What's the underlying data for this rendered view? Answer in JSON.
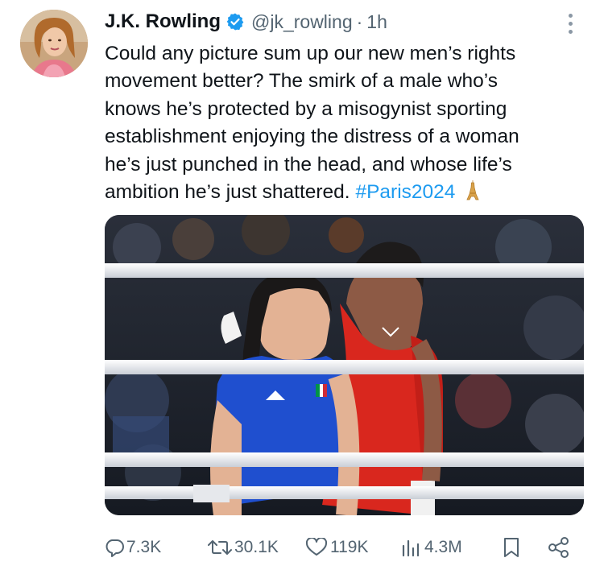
{
  "tweet": {
    "author": {
      "name": "J.K. Rowling",
      "handle": "@jk_rowling",
      "separator": "·",
      "time": "1h",
      "avatar_icon": "author-avatar",
      "verified_color": "#1d9bf0"
    },
    "text_lines": [
      "Could any picture sum up our new men’s rights",
      "movement better? The smirk of a male who’s",
      "knows he’s protected by a misogynist sporting",
      "establishment enjoying the distress of a woman",
      "he’s just punched in the head, and whose life’s",
      "ambition he’s just shattered."
    ],
    "hashtag": "#Paris2024",
    "emoji_icon": "eiffel-tower-icon",
    "media_icon": "boxing-ring-photo",
    "actions": {
      "replies": "7.3K",
      "reposts": "30.1K",
      "likes": "119K",
      "views": "4.3M"
    },
    "colors": {
      "text": "#0f1419",
      "muted": "#536471",
      "accent": "#1d9bf0"
    }
  }
}
